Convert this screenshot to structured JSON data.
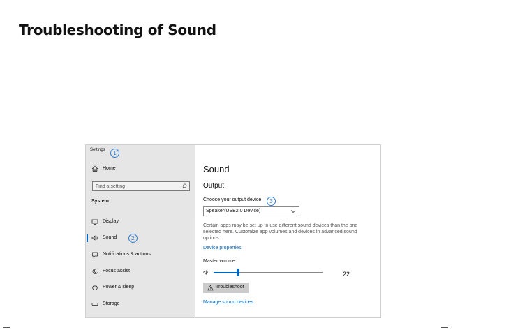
{
  "document": {
    "title": "Troubleshooting of Sound"
  },
  "settings_window": {
    "app_title": "Settings",
    "markers": [
      "1",
      "2",
      "3"
    ],
    "sidebar": {
      "home_label": "Home",
      "search_placeholder": "Find a setting",
      "section_label": "System",
      "items": [
        {
          "label": "Display",
          "icon": "monitor-icon"
        },
        {
          "label": "Sound",
          "icon": "speaker-icon",
          "selected": true
        },
        {
          "label": "Notifications & actions",
          "icon": "notification-icon"
        },
        {
          "label": "Focus assist",
          "icon": "moon-icon"
        },
        {
          "label": "Power & sleep",
          "icon": "power-icon"
        },
        {
          "label": "Storage",
          "icon": "storage-icon"
        }
      ]
    },
    "main": {
      "title": "Sound",
      "output_heading": "Output",
      "choose_device_label": "Choose your output device",
      "selected_device": "Speaker(USB2.0 Device)",
      "description": "Certain apps may be set up to use different sound devices than the one selected here. Customize app volumes and devices in advanced sound options.",
      "device_properties_link": "Device properties",
      "master_volume_label": "Master volume",
      "volume_value": "22",
      "volume_fraction": 0.22,
      "troubleshoot_label": "Troubleshoot",
      "manage_devices_link": "Manage sound devices"
    }
  },
  "colors": {
    "accent": "#0067c0",
    "marker": "#2e7bd6",
    "sidebar_bg": "#e6e6e6"
  }
}
